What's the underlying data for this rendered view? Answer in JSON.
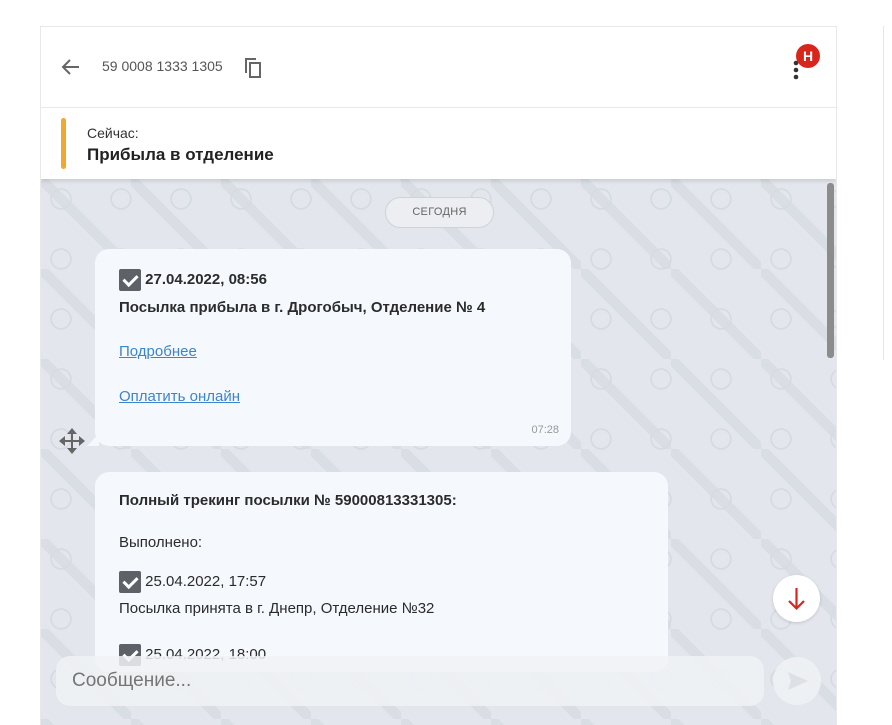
{
  "header": {
    "tracking_number": "59 0008 1333 1305",
    "badge": "H"
  },
  "status": {
    "label": "Сейчас:",
    "value": "Прибыла в отделение"
  },
  "chat": {
    "date_divider": "СЕГОДНЯ",
    "message1": {
      "datetime": "27.04.2022, 08:56",
      "text": "Посылка прибыла в г. Дрогобыч, Отделение № 4",
      "link_details": "Подробнее",
      "link_pay": "Оплатить онлайн",
      "time": "07:28"
    },
    "message2": {
      "title": "Полный трекинг посылки № 59000813331305:",
      "done_label": "Выполнено:",
      "events": [
        {
          "datetime": "25.04.2022, 17:57",
          "text": "Посылка принята в г. Днепр, Отделение №32"
        },
        {
          "datetime": "25.04.2022, 18:00",
          "text": ""
        }
      ]
    },
    "input_placeholder": "Сообщение..."
  },
  "colors": {
    "accent": "#f0a830",
    "badge": "#d9261c",
    "link": "#3d84cf",
    "arrow": "#d9261c"
  }
}
